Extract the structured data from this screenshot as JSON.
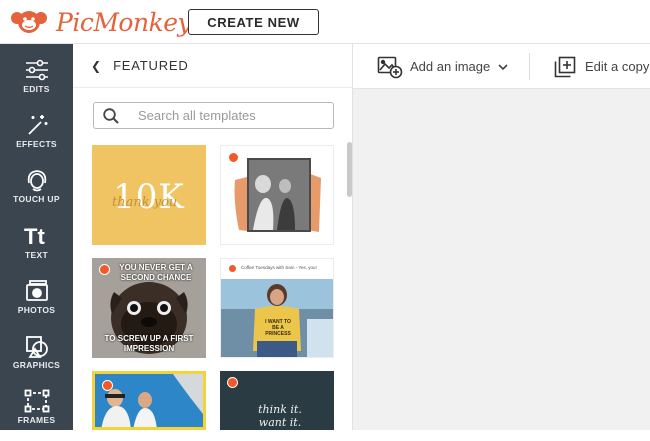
{
  "app": {
    "brand": "PicMonkey",
    "brand_color": "#e4633c"
  },
  "toolbar": {
    "create_label": "CREATE NEW"
  },
  "nav": {
    "items": [
      {
        "label": "EDITS",
        "icon": "sliders-icon"
      },
      {
        "label": "EFFECTS",
        "icon": "magic-wand-icon"
      },
      {
        "label": "TOUCH UP",
        "icon": "face-icon"
      },
      {
        "label": "TEXT",
        "icon": "text-icon"
      },
      {
        "label": "PHOTOS",
        "icon": "photo-icon"
      },
      {
        "label": "GRAPHICS",
        "icon": "shapes-icon"
      },
      {
        "label": "FRAMES",
        "icon": "frame-icon"
      }
    ]
  },
  "panel": {
    "title": "FEATURED",
    "search_placeholder": "Search all templates",
    "templates": [
      {
        "text": "10K",
        "subtext": "thank you",
        "bg": "#f1c463"
      },
      {
        "text": "",
        "bg": "#ffffff"
      },
      {
        "text_top": "YOU NEVER GET A SECOND CHANCE",
        "text_bottom": "TO SCREW UP A FIRST IMPRESSION",
        "bg": "#8c8c8c"
      },
      {
        "caption": "Coffee Tuesdays with Sam - Yes, you!",
        "shirt_text": "I WANT TO BE A PRINCESS",
        "bg": "#8fb8d4"
      },
      {
        "text": "",
        "bg": "#2b79b8"
      },
      {
        "text": "think it. want it.",
        "bg": "#2b3b44"
      }
    ]
  },
  "workspace": {
    "add_image_label": "Add an image",
    "edit_copy_label": "Edit a copy"
  }
}
